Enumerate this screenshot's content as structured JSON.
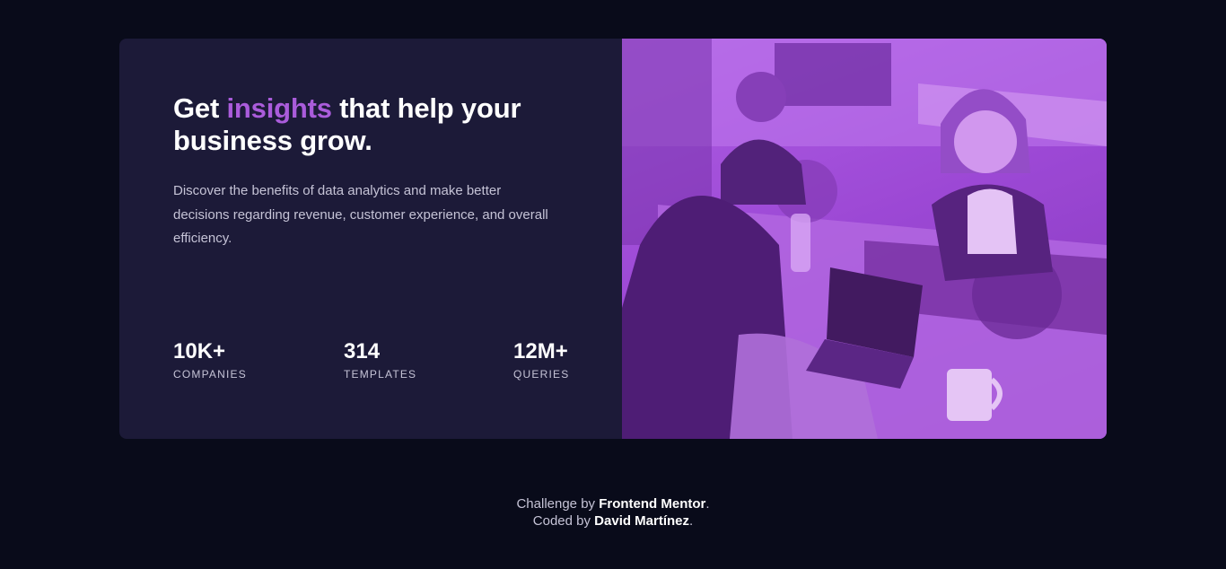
{
  "card": {
    "headline": {
      "before": "Get ",
      "accent": "insights",
      "after": " that help your business grow."
    },
    "description": "Discover the benefits of data analytics and make better decisions regarding revenue, customer experience, and overall efficiency.",
    "stats": [
      {
        "value": "10K+",
        "label": "COMPANIES"
      },
      {
        "value": "314",
        "label": "TEMPLATES"
      },
      {
        "value": "12M+",
        "label": "QUERIES"
      }
    ]
  },
  "footer": {
    "line1_prefix": "Challenge by ",
    "line1_name": "Frontend Mentor",
    "line1_suffix": ".",
    "line2_prefix": "Coded by ",
    "line2_name": "David Martínez",
    "line2_suffix": "."
  },
  "colors": {
    "page_background": "#090b1a",
    "card_background": "#1c1a38",
    "accent": "#aa5cdb",
    "muted_text": "#c5c3d6"
  }
}
